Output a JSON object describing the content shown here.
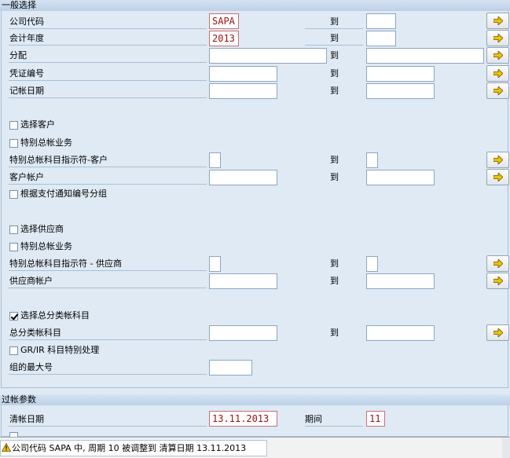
{
  "general": {
    "title": "一般选择",
    "to_label": "到",
    "company_code": {
      "label": "公司代码",
      "from": "SAPA",
      "to": ""
    },
    "fiscal_year": {
      "label": "会计年度",
      "from": "2013",
      "to": ""
    },
    "assignment": {
      "label": "分配",
      "from": "",
      "to": ""
    },
    "document_number": {
      "label": "凭证编号",
      "from": "",
      "to": ""
    },
    "posting_date": {
      "label": "记帐日期",
      "from": "",
      "to": ""
    },
    "customer": {
      "select_label": "选择客户",
      "select_checked": false,
      "special_gl_label": "特别总帐业务",
      "special_gl_checked": false,
      "special_ind_label": "特别总帐科目指示符-客户",
      "account_label": "客户帐户",
      "group_by_payment_label": "根据支付通知编号分组",
      "group_by_payment_checked": false
    },
    "vendor": {
      "select_label": "选择供应商",
      "select_checked": false,
      "special_gl_label": "特别总帐业务",
      "special_gl_checked": false,
      "special_ind_label": "特别总帐科目指示符 - 供应商",
      "account_label": "供应商帐户"
    },
    "gl": {
      "select_label": "选择总分类帐科目",
      "select_checked": true,
      "account_label": "总分类帐科目",
      "grir_label": "GR/IR 科目特别处理",
      "grir_checked": false,
      "max_group_label": "组的最大号",
      "max_group": ""
    }
  },
  "posting": {
    "title": "过帐参数",
    "clearing_date_label": "清帐日期",
    "clearing_date": "13.11.2013",
    "period_label": "期间",
    "period": "11"
  },
  "status": {
    "message": "公司代码 SAPA 中, 周期 10 被调整到 清算日期 13.11.2013",
    "type": "warning"
  },
  "icons": {
    "multiple_selection": "multiple-selection-arrow-icon",
    "warning": "warning-icon"
  },
  "colors": {
    "background": "#dfeaf5",
    "header": "#c8d9eb",
    "value_text": "#9b1010",
    "button_arrow": "#f2c200"
  }
}
